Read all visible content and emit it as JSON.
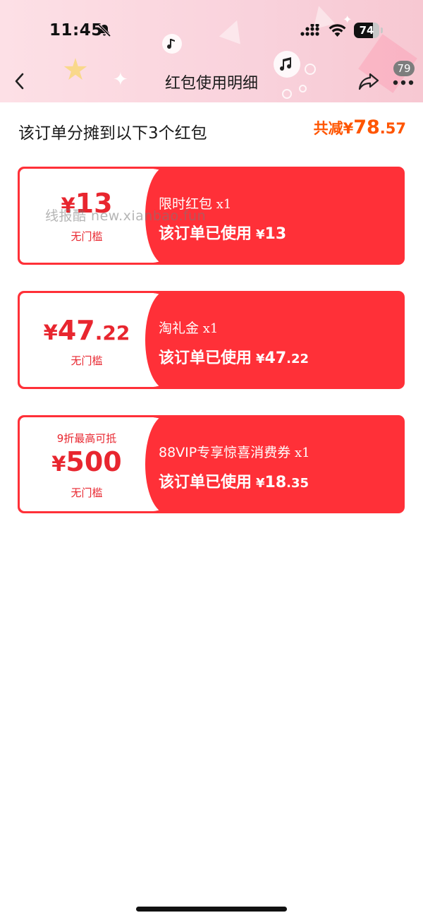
{
  "status_bar": {
    "time": "11:45",
    "battery_level": "74",
    "battery_fraction": 0.74
  },
  "nav": {
    "title": "红包使用明细",
    "more_badge": "79"
  },
  "summary": {
    "title": "该订单分摊到以下3个红包",
    "total_label": "共减¥",
    "total_int": "78",
    "total_dec": ".57"
  },
  "coupons": [
    {
      "yen": "¥",
      "amount_int": "13",
      "amount_dec": "",
      "threshold": "",
      "condition": "无门槛",
      "name": "限时红包",
      "qty": " x1",
      "used_label": "该订单已使用",
      "used_yen": "¥",
      "used_int": "13",
      "used_dec": ""
    },
    {
      "yen": "¥",
      "amount_int": "47",
      "amount_dec": ".22",
      "threshold": "",
      "condition": "无门槛",
      "name": "淘礼金",
      "qty": " x1",
      "used_label": "该订单已使用",
      "used_yen": "¥",
      "used_int": "47",
      "used_dec": ".22"
    },
    {
      "yen": "¥",
      "amount_int": "500",
      "amount_dec": "",
      "threshold": "9折最高可抵",
      "condition": "无门槛",
      "name": "88VIP专享惊喜消费券",
      "qty": " x1",
      "used_label": "该订单已使用",
      "used_yen": "¥",
      "used_int": "18",
      "used_dec": ".35"
    }
  ],
  "watermark": "线报酷 new.xianbao.fun",
  "colors": {
    "accent_red": "#ff3038",
    "amount_red": "#e8262f",
    "total_orange": "#ff5500",
    "header_pink": "#fbd8e0"
  },
  "icons": [
    "bell-slash-icon",
    "signal-icon",
    "wifi-icon",
    "battery-icon",
    "back-chevron-icon",
    "share-icon",
    "more-icon",
    "music-note-icon"
  ]
}
